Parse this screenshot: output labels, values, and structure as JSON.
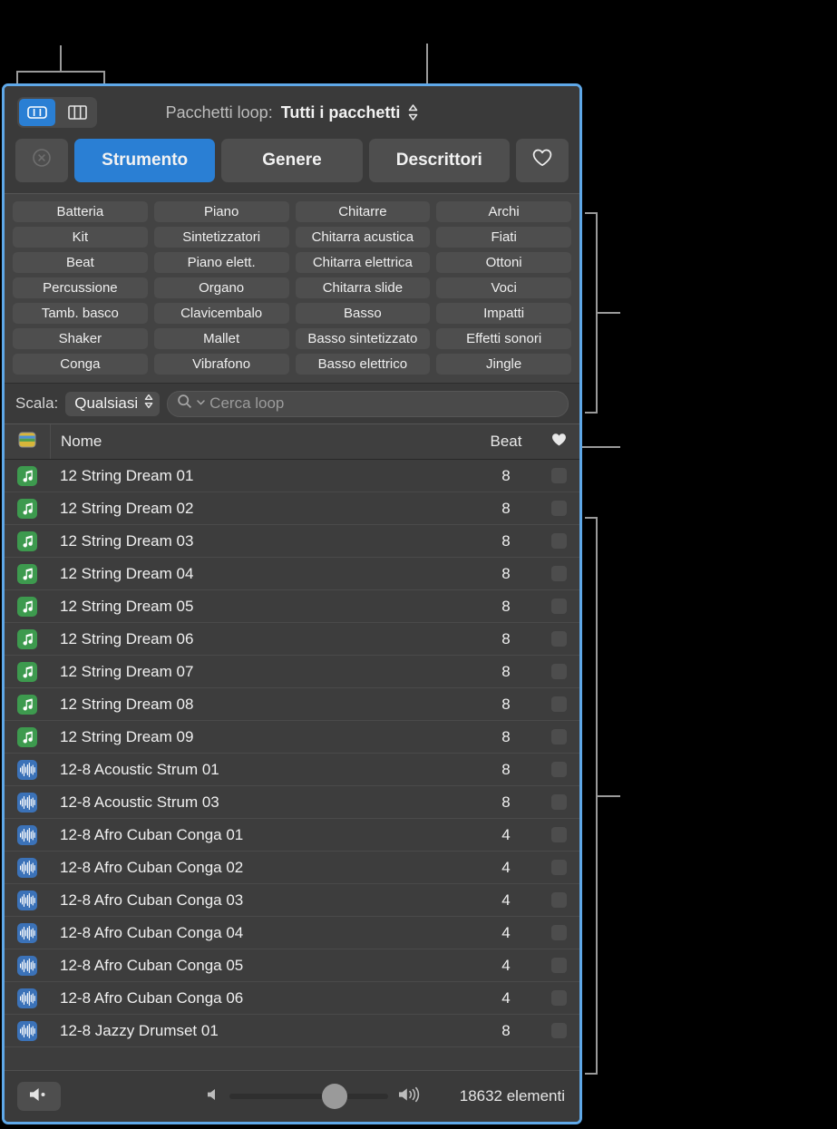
{
  "window": {
    "accent_border": "#5fa8e8",
    "accent_blue": "#2a7fd4"
  },
  "topbar": {
    "view_grid_icon": "grid-view-icon",
    "view_column_icon": "column-view-icon",
    "packages_label": "Pacchetti loop:",
    "packages_value": "Tutti i pacchetti",
    "stepper_up": "▴",
    "stepper_down": "▾"
  },
  "tabs": {
    "reset_icon": "reset-circle-x-icon",
    "items": [
      {
        "label": "Strumento",
        "active": true
      },
      {
        "label": "Genere",
        "active": false
      },
      {
        "label": "Descrittori",
        "active": false
      }
    ],
    "favorites_icon": "heart-outline-icon"
  },
  "keywords": [
    "Batteria",
    "Piano",
    "Chitarre",
    "Archi",
    "Kit",
    "Sintetizzatori",
    "Chitarra acustica",
    "Fiati",
    "Beat",
    "Piano elett.",
    "Chitarra elettrica",
    "Ottoni",
    "Percussione",
    "Organo",
    "Chitarra slide",
    "Voci",
    "Tamb. basco",
    "Clavicembalo",
    "Basso",
    "Impatti",
    "Shaker",
    "Mallet",
    "Basso sintetizzato",
    "Effetti sonori",
    "Conga",
    "Vibrafono",
    "Basso elettrico",
    "Jingle"
  ],
  "scale_row": {
    "label": "Scala:",
    "value": "Qualsiasi",
    "search_icon": "search-magnifier-icon",
    "search_chevron": "chevron-down-icon",
    "search_placeholder": "Cerca loop",
    "search_value": ""
  },
  "list_header": {
    "type_icon": "library-stripes-icon",
    "name": "Nome",
    "beat": "Beat",
    "favorite_icon": "heart-filled-icon"
  },
  "rows": [
    {
      "icon": "midi-note-icon",
      "name": "12 String Dream 01",
      "beat": "8",
      "favorite": false
    },
    {
      "icon": "midi-note-icon",
      "name": "12 String Dream 02",
      "beat": "8",
      "favorite": false
    },
    {
      "icon": "midi-note-icon",
      "name": "12 String Dream 03",
      "beat": "8",
      "favorite": false
    },
    {
      "icon": "midi-note-icon",
      "name": "12 String Dream 04",
      "beat": "8",
      "favorite": false
    },
    {
      "icon": "midi-note-icon",
      "name": "12 String Dream 05",
      "beat": "8",
      "favorite": false
    },
    {
      "icon": "midi-note-icon",
      "name": "12 String Dream 06",
      "beat": "8",
      "favorite": false
    },
    {
      "icon": "midi-note-icon",
      "name": "12 String Dream 07",
      "beat": "8",
      "favorite": false
    },
    {
      "icon": "midi-note-icon",
      "name": "12 String Dream 08",
      "beat": "8",
      "favorite": false
    },
    {
      "icon": "midi-note-icon",
      "name": "12 String Dream 09",
      "beat": "8",
      "favorite": false
    },
    {
      "icon": "audio-wave-icon",
      "name": "12-8 Acoustic Strum 01",
      "beat": "8",
      "favorite": false
    },
    {
      "icon": "audio-wave-icon",
      "name": "12-8 Acoustic Strum 03",
      "beat": "8",
      "favorite": false
    },
    {
      "icon": "audio-wave-icon",
      "name": "12-8 Afro Cuban Conga 01",
      "beat": "4",
      "favorite": false
    },
    {
      "icon": "audio-wave-icon",
      "name": "12-8 Afro Cuban Conga 02",
      "beat": "4",
      "favorite": false
    },
    {
      "icon": "audio-wave-icon",
      "name": "12-8 Afro Cuban Conga 03",
      "beat": "4",
      "favorite": false
    },
    {
      "icon": "audio-wave-icon",
      "name": "12-8 Afro Cuban Conga 04",
      "beat": "4",
      "favorite": false
    },
    {
      "icon": "audio-wave-icon",
      "name": "12-8 Afro Cuban Conga 05",
      "beat": "4",
      "favorite": false
    },
    {
      "icon": "audio-wave-icon",
      "name": "12-8 Afro Cuban Conga 06",
      "beat": "4",
      "favorite": false
    },
    {
      "icon": "audio-wave-icon",
      "name": "12-8 Jazzy Drumset 01",
      "beat": "8",
      "favorite": false
    }
  ],
  "bottombar": {
    "mute_icon": "speaker-mute-icon",
    "volume_low_icon": "speaker-low-icon",
    "volume_high_icon": "speaker-high-icon",
    "volume_percent": 58,
    "item_count": "18632 elementi"
  }
}
